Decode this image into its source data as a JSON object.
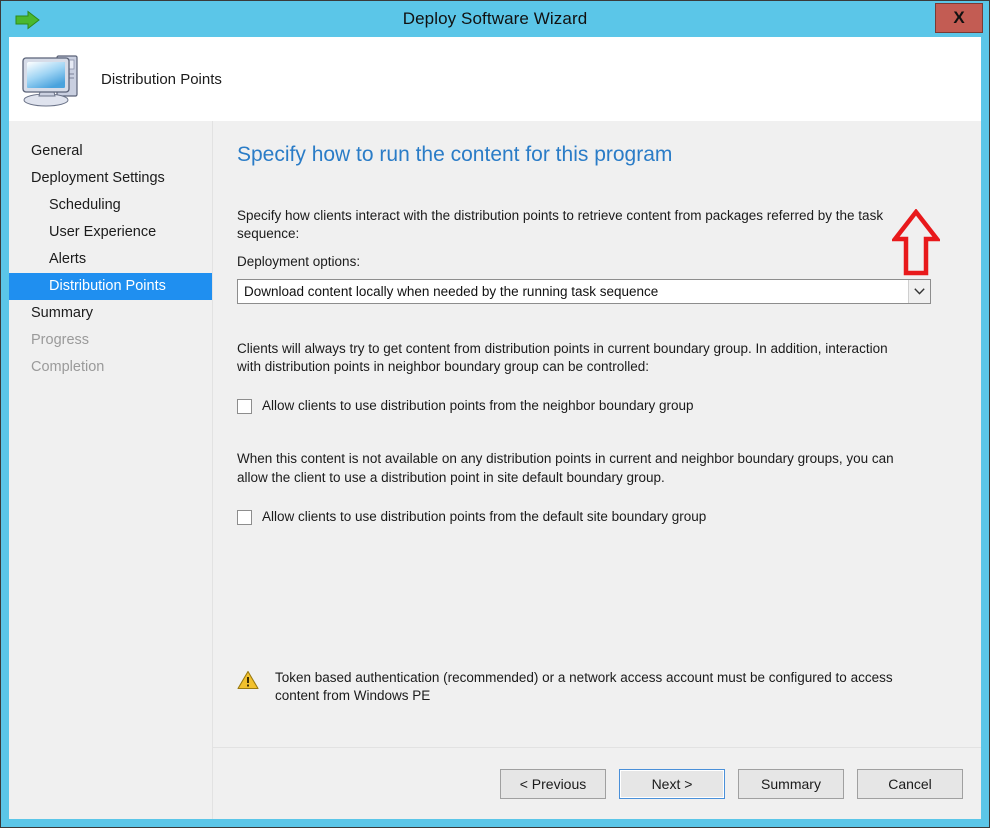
{
  "window": {
    "title": "Deploy Software Wizard",
    "back_icon": "green-right-arrow-icon",
    "close_label": "X"
  },
  "banner": {
    "icon": "computer-icon",
    "title": "Distribution Points"
  },
  "sidebar": {
    "items": [
      {
        "label": "General",
        "level": 0,
        "state": "normal"
      },
      {
        "label": "Deployment Settings",
        "level": 0,
        "state": "normal"
      },
      {
        "label": "Scheduling",
        "level": 1,
        "state": "normal"
      },
      {
        "label": "User Experience",
        "level": 1,
        "state": "normal"
      },
      {
        "label": "Alerts",
        "level": 1,
        "state": "normal"
      },
      {
        "label": "Distribution Points",
        "level": 1,
        "state": "selected"
      },
      {
        "label": "Summary",
        "level": 0,
        "state": "normal"
      },
      {
        "label": "Progress",
        "level": 0,
        "state": "disabled"
      },
      {
        "label": "Completion",
        "level": 0,
        "state": "disabled"
      }
    ]
  },
  "content": {
    "heading": "Specify how to run the content for this program",
    "intro_text": "Specify how clients interact with the distribution points to retrieve content from packages referred by the task sequence:",
    "deployment_options_label": "Deployment options:",
    "deployment_combo": {
      "value": "Download content locally when needed by the running task sequence",
      "arrow_icon": "chevron-down-icon"
    },
    "neighbor_description": "Clients will always try to get content from distribution points in current boundary group. In addition, interaction with distribution points in neighbor boundary group can be controlled:",
    "neighbor_checkbox": {
      "label": "Allow clients to use distribution points from the neighbor boundary group",
      "checked": false
    },
    "default_site_description": "When this content is not available on any distribution points in current and neighbor boundary groups, you can allow the client to use a distribution point in site default boundary group.",
    "default_site_checkbox": {
      "label": "Allow clients to use distribution points from the default site boundary group",
      "checked": false
    },
    "warning": {
      "icon": "warning-triangle-icon",
      "text": "Token based authentication (recommended) or a network access account must be configured to access content from Windows PE"
    }
  },
  "annotation": {
    "arrow_icon": "red-up-arrow-annotation",
    "color": "#e8191b"
  },
  "footer": {
    "buttons": [
      {
        "label": "< Previous",
        "focused": false
      },
      {
        "label": "Next >",
        "focused": true
      },
      {
        "label": "Summary",
        "focused": false
      },
      {
        "label": "Cancel",
        "focused": false
      }
    ]
  },
  "colors": {
    "window_frame": "#5bc6e8",
    "selection": "#1f8ff0",
    "heading": "#2a7cc7",
    "close_button": "#c35c53",
    "warning": "#f2c12e",
    "annotation": "#e8191b"
  }
}
